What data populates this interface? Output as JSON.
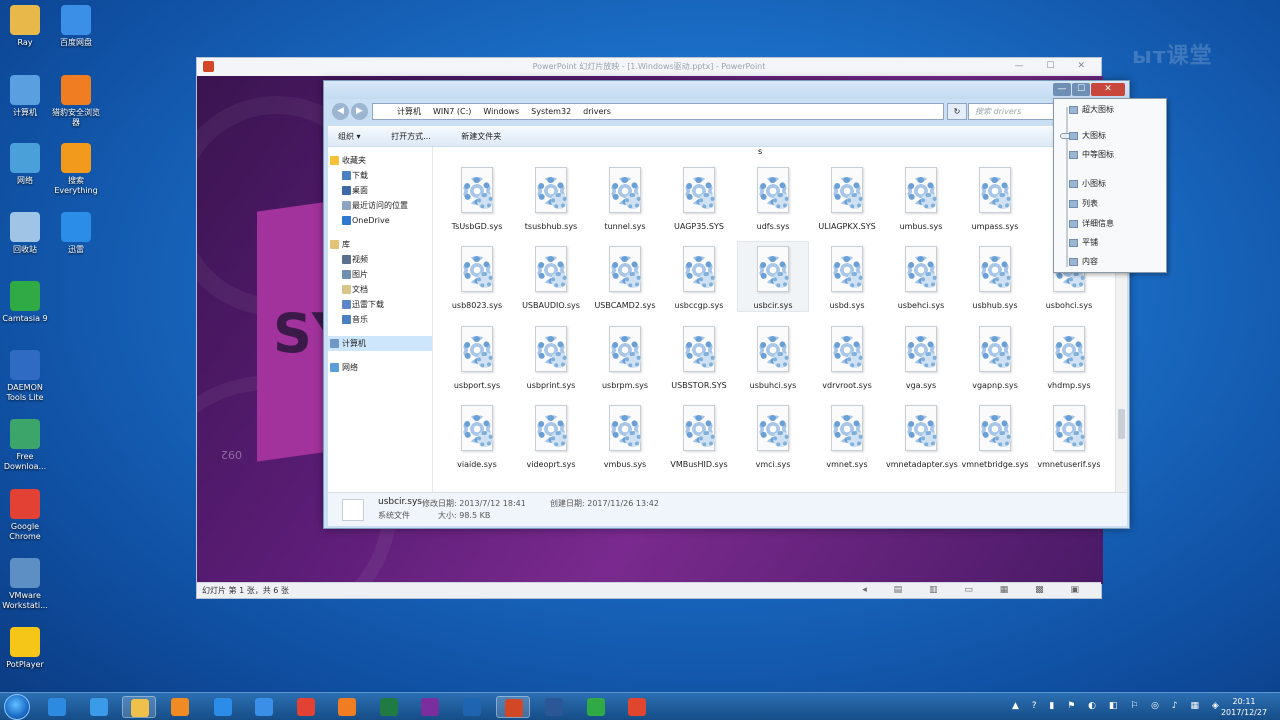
{
  "watermark": "ыт课堂",
  "desktop": {
    "icons": [
      {
        "label": "Ray",
        "icon": "folder-user-icon",
        "color": "#e8b84a"
      },
      {
        "label": "百度网盘",
        "icon": "baidu-cloud-icon",
        "color": "#3b8fe6"
      },
      {
        "label": "计算机",
        "icon": "computer-icon",
        "color": "#5aa0e0"
      },
      {
        "label": "猎豹安全浏览器",
        "icon": "cheetah-browser-icon",
        "color": "#f07d22"
      },
      {
        "label": "网络",
        "icon": "network-icon",
        "color": "#4aa0d8"
      },
      {
        "label": "搜索Everything",
        "icon": "everything-search-icon",
        "color": "#f29a1c"
      },
      {
        "label": "回收站",
        "icon": "recycle-bin-icon",
        "color": "#9fc4e6"
      },
      {
        "label": "迅雷",
        "icon": "xunlei-icon",
        "color": "#2c8de8"
      },
      {
        "label": "Camtasia 9",
        "icon": "camtasia-icon",
        "color": "#2faa45"
      },
      {
        "label": "DAEMON Tools Lite",
        "icon": "daemon-tools-icon",
        "color": "#2f6bc2"
      },
      {
        "label": "Free Downloa...",
        "icon": "free-download-icon",
        "color": "#3ba56a"
      },
      {
        "label": "Google Chrome",
        "icon": "chrome-icon",
        "color": "#e34133"
      },
      {
        "label": "VMware Workstati...",
        "icon": "vmware-icon",
        "color": "#5d8fc4"
      },
      {
        "label": "PotPlayer",
        "icon": "potplayer-icon",
        "color": "#f5c518"
      }
    ]
  },
  "powerpoint": {
    "title": "PowerPoint 幻灯片放映 - [1.Windows驱动.pptx] - PowerPoint",
    "window_buttons": "— ☐ ✕",
    "slide_big_text": "SY",
    "slide_number_text": "092",
    "status": "幻灯片 第 1 张，共 6 张",
    "status_icons": "◂ ▤ ▥ ▭ ▦ ▩ ▣"
  },
  "explorer": {
    "window_buttons": {
      "min": "—",
      "max": "☐",
      "close": "✕"
    },
    "back": "◀",
    "forward": "▶",
    "breadcrumb": [
      "计算机",
      "WIN7 (C:)",
      "Windows",
      "System32",
      "drivers"
    ],
    "refresh": "↻",
    "search_placeholder": "搜索 drivers",
    "toolbar": {
      "organize": "组织 ▾",
      "open_with": "打开方式...",
      "new_folder": "新建文件夹"
    },
    "nav": {
      "favorites": "收藏夹",
      "favorites_items": [
        "下载",
        "桌面",
        "最近访问的位置",
        "OneDrive"
      ],
      "libraries": "库",
      "library_items": [
        "视频",
        "图片",
        "文档",
        "迅雷下载",
        "音乐"
      ],
      "computer": "计算机",
      "network": "网络"
    },
    "top_fragment": "s",
    "files": [
      "TsUsbGD.sys",
      "tsusbhub.sys",
      "tunnel.sys",
      "UAGP35.SYS",
      "udfs.sys",
      "ULIAGPKX.SYS",
      "umbus.sys",
      "umpass.sys",
      "usb8023.sys",
      "USBAUDIO.sys",
      "USBCAMD2.sys",
      "usbccgp.sys",
      "usbcir.sys",
      "usbd.sys",
      "usbehci.sys",
      "usbhub.sys",
      "usbohci.sys",
      "usbport.sys",
      "usbprint.sys",
      "usbrpm.sys",
      "USBSTOR.SYS",
      "usbuhci.sys",
      "vdrvroot.sys",
      "vga.sys",
      "vgapnp.sys",
      "vhdmp.sys",
      "viaide.sys",
      "videoprt.sys",
      "vmbus.sys",
      "VMBusHID.sys",
      "vmci.sys",
      "vmnet.sys",
      "vmnetadapter.sys",
      "vmnetbridge.sys",
      "vmnetuserif.sys"
    ],
    "selected_file": "usbcir.sys",
    "details": {
      "name": "usbcir.sys",
      "type": "系统文件",
      "modified": "修改日期: 2013/7/12 18:41",
      "size": "大小: 98.5 KB",
      "created": "创建日期: 2017/11/26 13:42"
    }
  },
  "view_menu": {
    "items": [
      "超大图标",
      "大图标",
      "中等图标",
      "小图标",
      "列表",
      "详细信息",
      "平铺",
      "内容"
    ]
  },
  "taskbar": {
    "apps": [
      {
        "name": "ie-icon",
        "color": "#2c8be0"
      },
      {
        "name": "edge-icon",
        "color": "#3b9be8"
      },
      {
        "name": "explorer-icon",
        "color": "#f0c14a"
      },
      {
        "name": "media-player-icon",
        "color": "#f08a22"
      },
      {
        "name": "xunlei-icon",
        "color": "#2c8de8"
      },
      {
        "name": "baidu-cloud-icon",
        "color": "#3b8fe6"
      },
      {
        "name": "chrome-icon",
        "color": "#e34133"
      },
      {
        "name": "cheetah-browser-icon",
        "color": "#f07d22"
      },
      {
        "name": "excel-icon",
        "color": "#1f7a44"
      },
      {
        "name": "onenote-icon",
        "color": "#7b2f9e"
      },
      {
        "name": "outlook-icon",
        "color": "#1f64b0"
      },
      {
        "name": "powerpoint-icon",
        "color": "#d24726"
      },
      {
        "name": "word-icon",
        "color": "#2b5797"
      },
      {
        "name": "camtasia-icon",
        "color": "#2faa45"
      },
      {
        "name": "camtasia-recorder-icon",
        "color": "#e0452e"
      }
    ],
    "tray": "▲ ? ▮ ⚑ ◐ ◧ ⚐ ◎ ♪ ▦ ◈",
    "time": "20:11",
    "date": "2017/12/27"
  }
}
